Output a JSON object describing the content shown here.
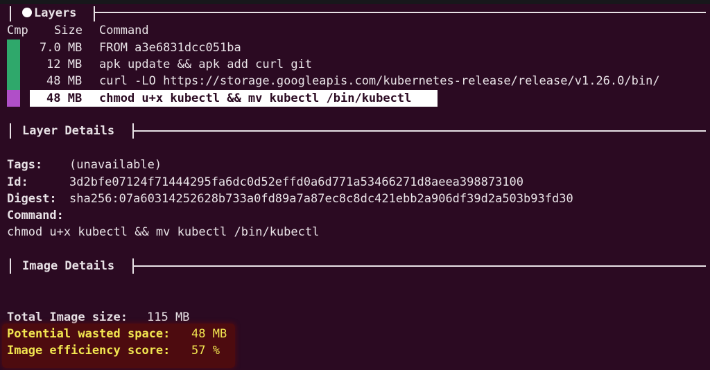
{
  "colors": {
    "background": "#2b0a22",
    "text": "#e8e2e6",
    "cmp_green": "#2fa86b",
    "cmp_magenta": "#b04fc8",
    "selection": "#ffffff",
    "warning": "#f2e650",
    "warning_bg": "#4d0b0f"
  },
  "layers_panel": {
    "title": "Layers",
    "columns": {
      "cmp": "Cmp",
      "size": "Size",
      "command": "Command"
    },
    "rows": [
      {
        "size": "7.0 MB",
        "command": "FROM a3e6831dcc051ba",
        "cmp": "green"
      },
      {
        "size": "12 MB",
        "command": "apk update && apk add curl git",
        "cmp": "green"
      },
      {
        "size": "48 MB",
        "command": "curl -LO https://storage.googleapis.com/kubernetes-release/release/v1.26.0/bin/",
        "cmp": "green"
      },
      {
        "size": "48 MB",
        "command": "chmod u+x kubectl && mv kubectl /bin/kubectl",
        "cmp": "magenta",
        "selected": true
      }
    ]
  },
  "layer_details": {
    "title": "Layer Details",
    "tags_label": "Tags:",
    "tags_value": "(unavailable)",
    "id_label": "Id:",
    "id_value": "3d2bfe07124f71444295fa6dc0d52effd0a6d771a53466271d8aeea398873100",
    "digest_label": "Digest:",
    "digest_value": "sha256:07a60314252628b733a0fd89a7a87ec8c8dc421ebb2a906df39d2a503b93fd30",
    "command_label": "Command:",
    "command_value": "chmod u+x kubectl && mv kubectl /bin/kubectl"
  },
  "image_details": {
    "title": "Image Details",
    "total_size_label": "Total Image size:",
    "total_size_value": "115 MB",
    "wasted_label": "Potential wasted space:",
    "wasted_value": "48 MB",
    "efficiency_label": "Image efficiency score:",
    "efficiency_value": "57 %"
  }
}
